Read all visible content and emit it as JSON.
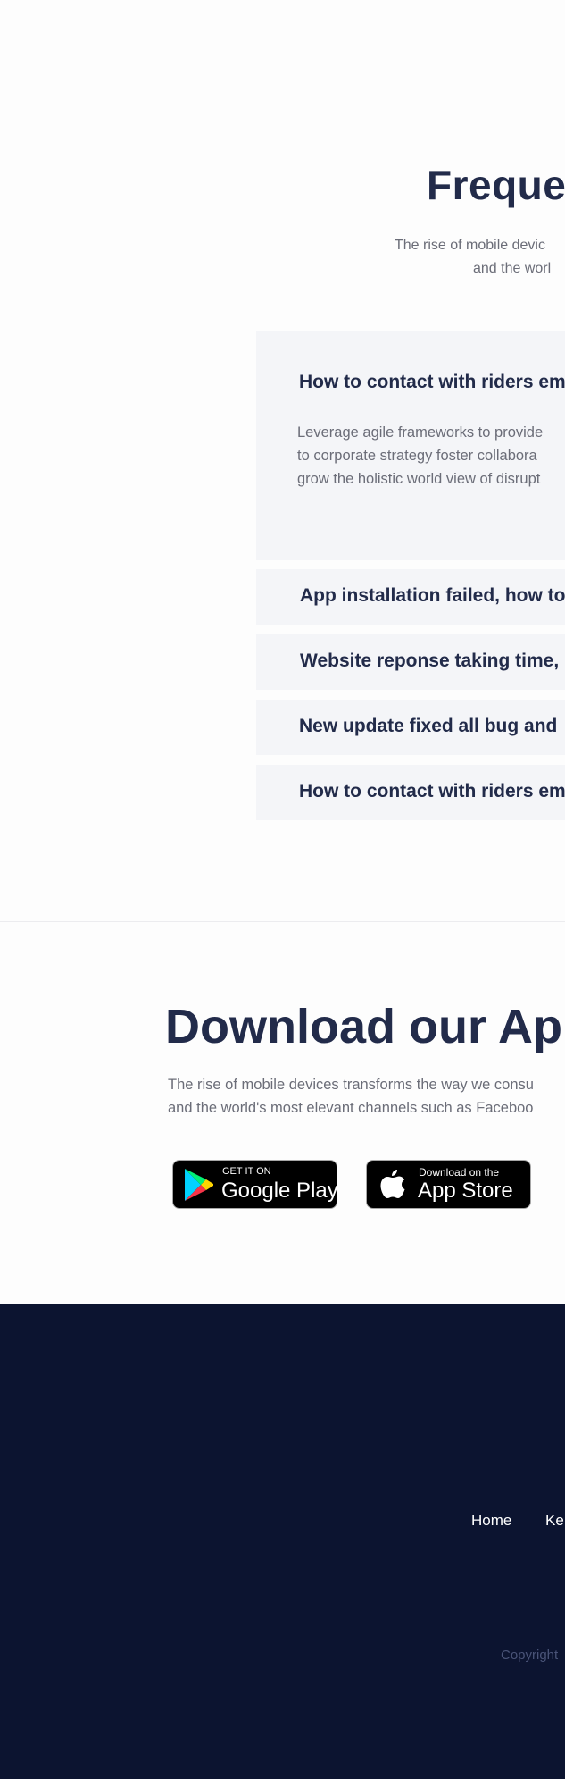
{
  "faq": {
    "title": "Frequen",
    "subtitle_line1": "The rise of mobile devic",
    "subtitle_line2": "and the worl",
    "items": [
      {
        "question": "How to contact with riders em",
        "expanded": true,
        "answer_lines": [
          "Leverage agile frameworks to provide",
          "to corporate strategy foster collabora",
          "grow the holistic world view of disrupt"
        ]
      },
      {
        "question": "App installation failed, how to",
        "expanded": false
      },
      {
        "question": "Website reponse taking time,",
        "expanded": false
      },
      {
        "question": "New update fixed all bug and",
        "expanded": false
      },
      {
        "question": "How to contact with riders em",
        "expanded": false
      }
    ]
  },
  "download": {
    "title": "Download our App",
    "text_line1": "The rise of mobile devices transforms the way we consu",
    "text_line2": "and the world's most elevant channels such as Faceboo",
    "google_play": {
      "small": "GET IT ON",
      "big": "Google Play",
      "icon": "google-play-icon"
    },
    "app_store": {
      "small": "Download on the",
      "big": "App Store",
      "icon": "apple-icon"
    }
  },
  "footer": {
    "links": [
      "Home",
      "Ke"
    ],
    "copyright": "Copyright"
  },
  "colors": {
    "heading": "#222b4a",
    "body_text": "#6b6d78",
    "faq_box": "#f4f5f8",
    "footer_bg": "#0c1430",
    "copyright": "#4a5478"
  }
}
